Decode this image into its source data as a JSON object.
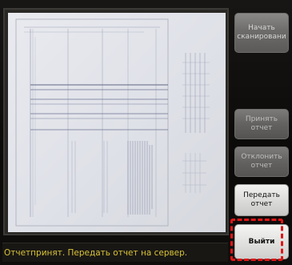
{
  "buttons": {
    "start_scan": "Начать сканировани",
    "accept_report": "Принять отчет",
    "reject_report": "Отклонить отчет",
    "send_report": "Передать отчет",
    "exit": "Выйти"
  },
  "status": {
    "message": "Отчетпринят. Передать отчет на сервер."
  },
  "colors": {
    "status_text": "#d8c338",
    "highlight": "#e01616"
  }
}
